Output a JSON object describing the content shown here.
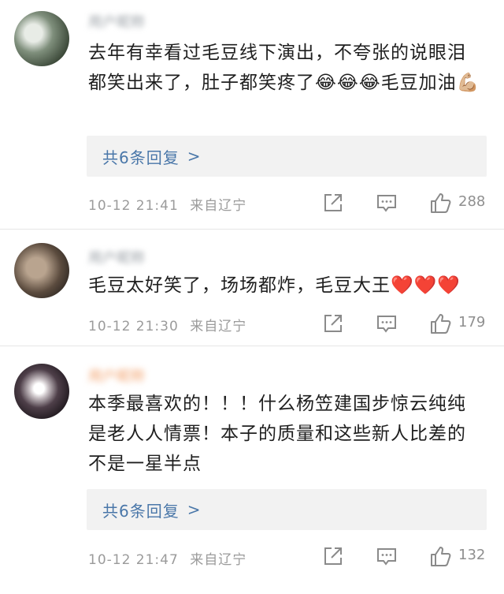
{
  "comments": [
    {
      "username": "用户昵称",
      "text": "去年有幸看过毛豆线下演出，不夸张的说眼泪都笑出来了，肚子都笑疼了😂😂😂毛豆加油💪🏼",
      "reply_label": "共6条回复",
      "reply_chevron": ">",
      "time": "10-12 21:41",
      "location": "来自辽宁",
      "likes": "288"
    },
    {
      "username": "用户昵称",
      "text": "毛豆太好笑了，场场都炸，毛豆大王❤️❤️❤️",
      "time": "10-12 21:30",
      "location": "来自辽宁",
      "likes": "179"
    },
    {
      "username": "用户昵称",
      "text": "本季最喜欢的！！！什么杨笠建国步惊云纯纯是老人人情票！本子的质量和这些新人比差的不是一星半点",
      "reply_label": "共6条回复",
      "reply_chevron": ">",
      "time": "10-12 21:47",
      "location": "来自辽宁",
      "likes": "132"
    }
  ]
}
